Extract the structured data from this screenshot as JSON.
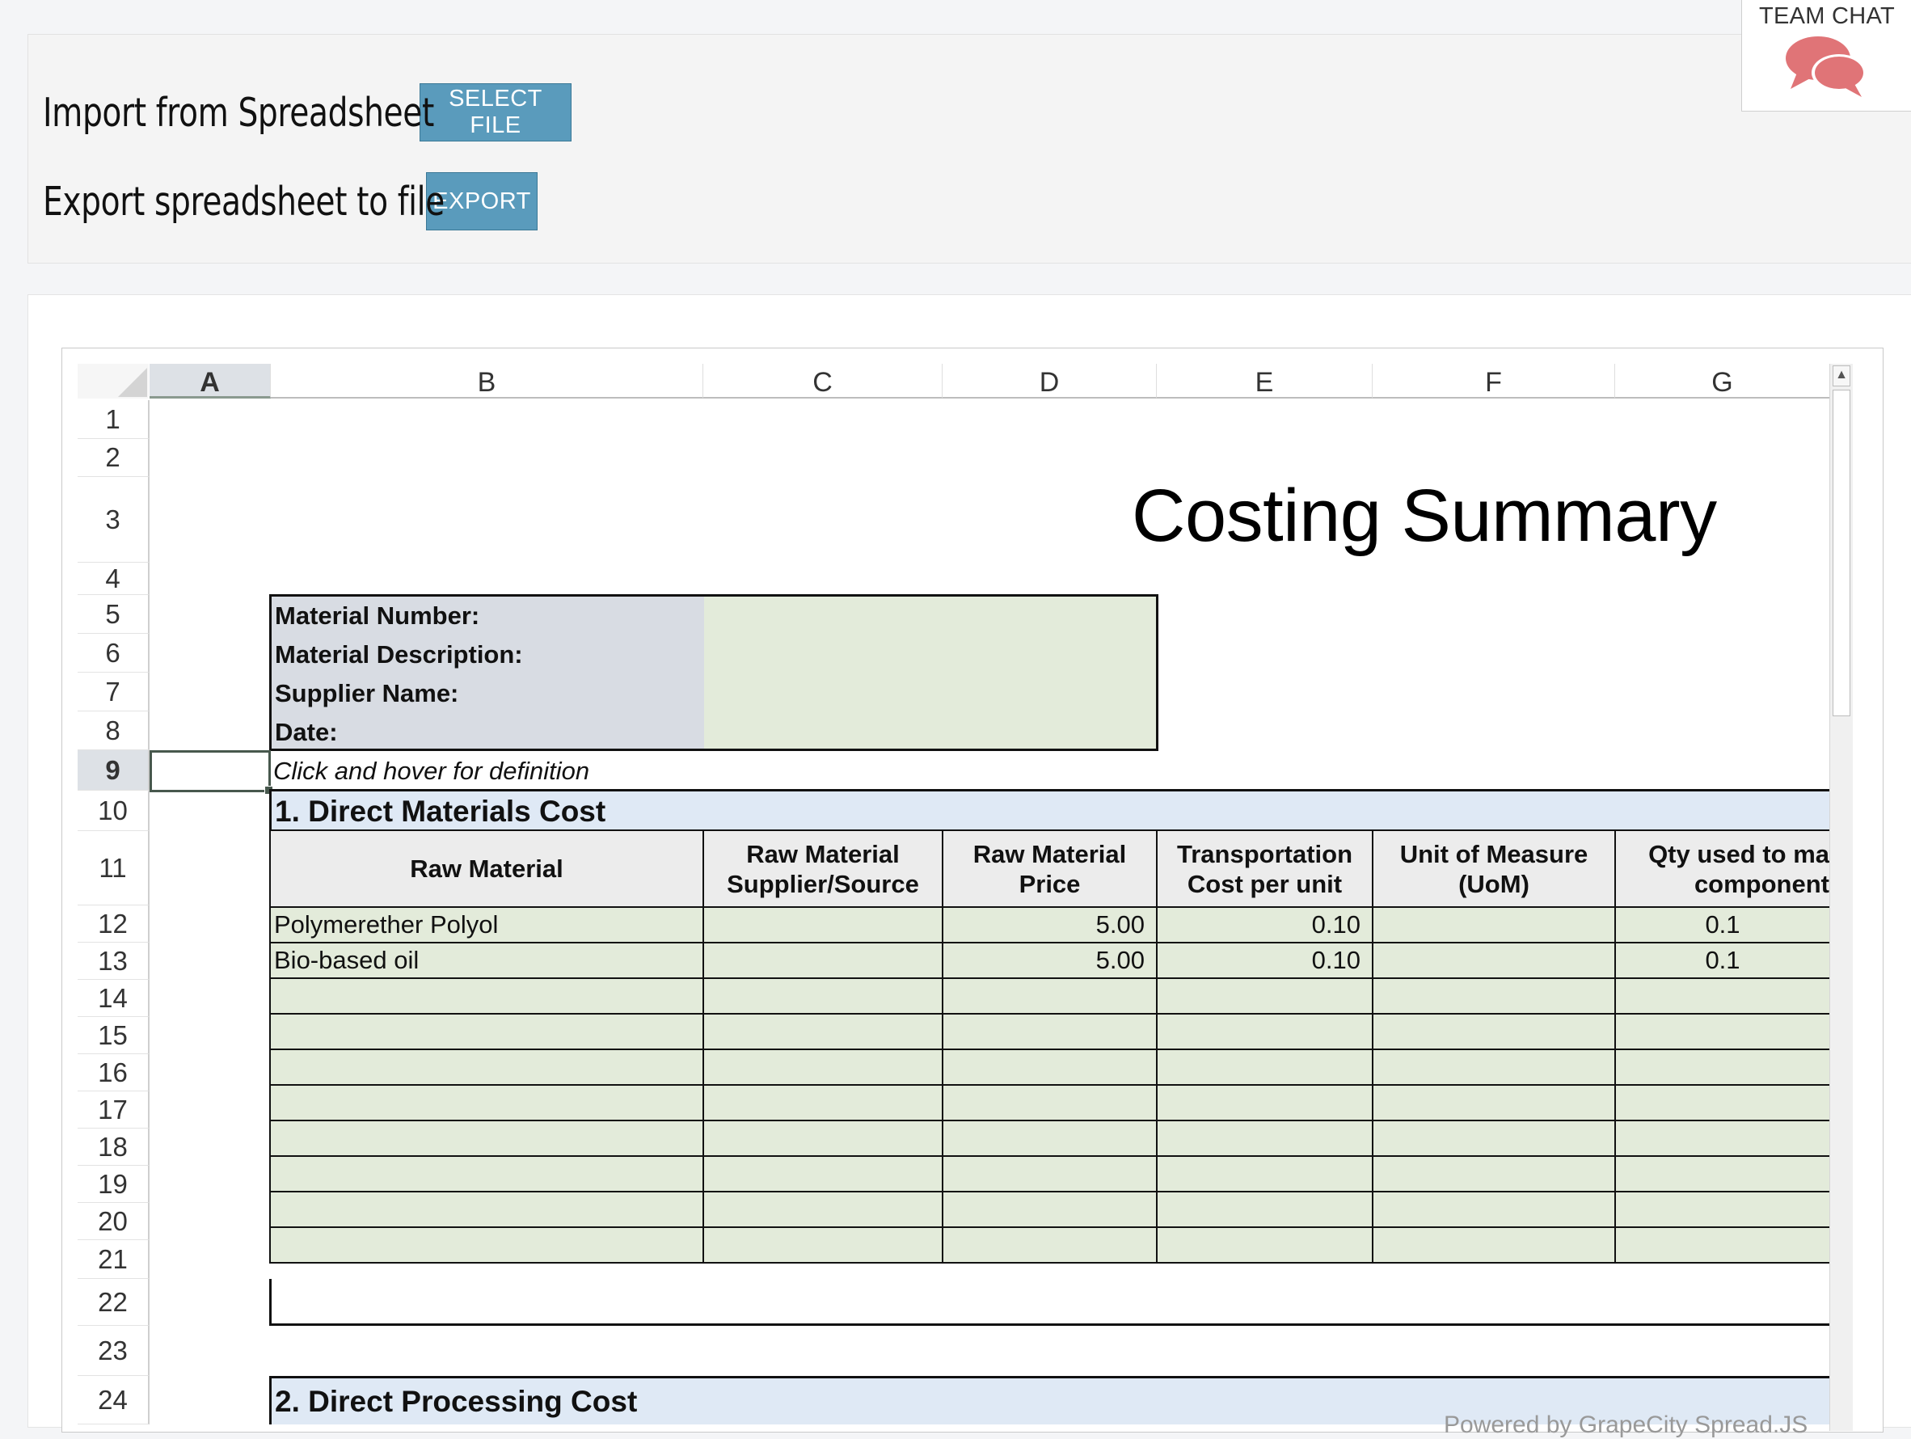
{
  "import_panel": {
    "import_label": "Import from Spreadsheet",
    "select_file_label": "SELECT FILE",
    "export_label": "Export spreadsheet to file",
    "export_button_label": "EXPORT"
  },
  "team_chat": {
    "label": "TEAM CHAT",
    "icon": "chat-bubbles-icon",
    "color": "#e07477"
  },
  "spreadsheet": {
    "columns": [
      "A",
      "B",
      "C",
      "D",
      "E",
      "F",
      "G"
    ],
    "active_column": "A",
    "rows": [
      "1",
      "2",
      "3",
      "4",
      "5",
      "6",
      "7",
      "8",
      "9",
      "10",
      "11",
      "12",
      "13",
      "14",
      "15",
      "16",
      "17",
      "18",
      "19",
      "20",
      "21",
      "22",
      "23",
      "24"
    ],
    "active_row": "9",
    "title": "Costing Summary",
    "info_labels": [
      "Material Number:",
      "Material Description:",
      "Supplier Name:",
      "Date:"
    ],
    "hint": "Click and hover for definition",
    "section1_title": "1. Direct Materials Cost",
    "section2_title": "2. Direct Processing Cost",
    "table_headers": [
      "Raw Material",
      "Raw Material\nSupplier/Source",
      "Raw Material\nPrice",
      "Transportation\nCost per unit",
      "Unit of Measure\n(UoM)",
      "Qty used to ma\ncomponent"
    ],
    "table_rows": [
      [
        "Polymerether Polyol",
        "",
        "5.00",
        "0.10",
        "",
        "0.1"
      ],
      [
        "Bio-based oil",
        "",
        "5.00",
        "0.10",
        "",
        "0.1"
      ],
      [
        "",
        "",
        "",
        "",
        "",
        ""
      ],
      [
        "",
        "",
        "",
        "",
        "",
        ""
      ],
      [
        "",
        "",
        "",
        "",
        "",
        ""
      ],
      [
        "",
        "",
        "",
        "",
        "",
        ""
      ],
      [
        "",
        "",
        "",
        "",
        "",
        ""
      ],
      [
        "",
        "",
        "",
        "",
        "",
        ""
      ],
      [
        "",
        "",
        "",
        "",
        "",
        ""
      ],
      [
        "",
        "",
        "",
        "",
        "",
        ""
      ]
    ],
    "powered_by": "Powered by GrapeCity Spread.JS",
    "colors": {
      "info_label_bg": "#d8dce3",
      "input_bg": "#e3ebda",
      "section_bg": "#dfe9f5"
    }
  }
}
